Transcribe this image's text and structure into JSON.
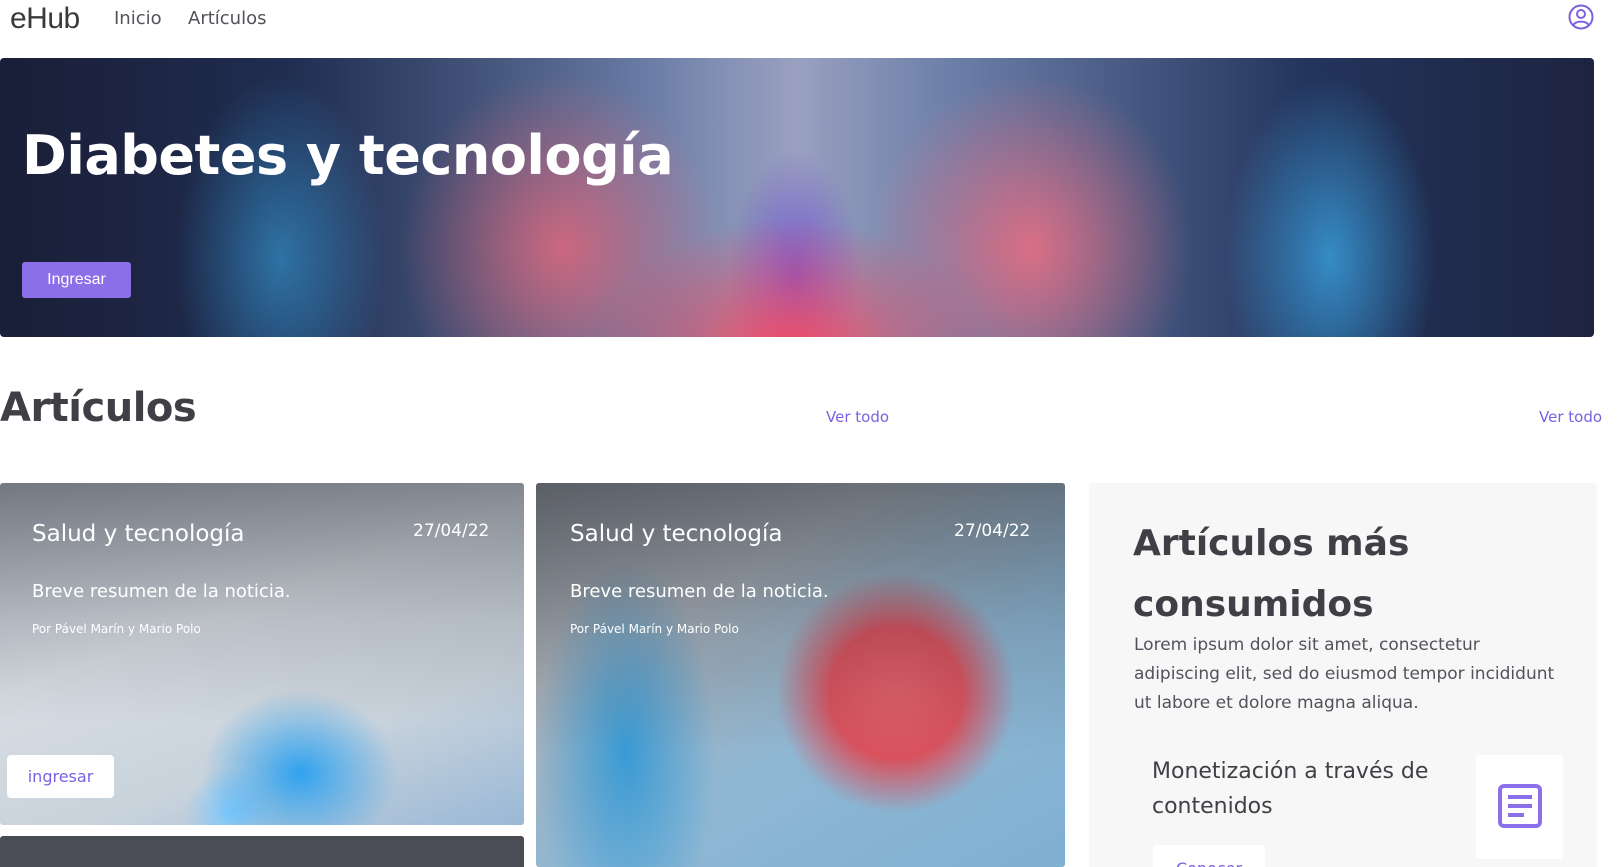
{
  "nav": {
    "brand": "eHub",
    "links": [
      "Inicio",
      "Artículos"
    ]
  },
  "hero": {
    "title": "Diabetes y tecnología",
    "button_label": "Ingresar"
  },
  "articles_section": {
    "title": "Artículos",
    "see_all": [
      "Ver todo",
      "Ver todo"
    ]
  },
  "cards": [
    {
      "title": "Salud y tecnología",
      "date": "27/04/22",
      "summary": "Breve resumen de la noticia.",
      "author": "Por Pável Marín y Mario Polo",
      "button_label": "ingresar"
    },
    {
      "title": "Salud y tecnología",
      "date": "27/04/22",
      "summary": "Breve resumen de la noticia.",
      "author": "Por Pável Marín y Mario Polo"
    }
  ],
  "popular": {
    "title": "Artículos más consumidos",
    "text": "Lorem ipsum dolor sit amet, consectetur adipiscing elit, sed do eiusmod tempor incididunt ut labore et dolore magna aliqua.",
    "item": {
      "title": "Monetización a través de contenidos",
      "icon": "document-icon",
      "button_label": "Conocer"
    }
  },
  "colors": {
    "accent": "#8b6fe8",
    "link": "#7b61e0",
    "text": "#3f3f46",
    "panel": "#f7f7f8"
  }
}
